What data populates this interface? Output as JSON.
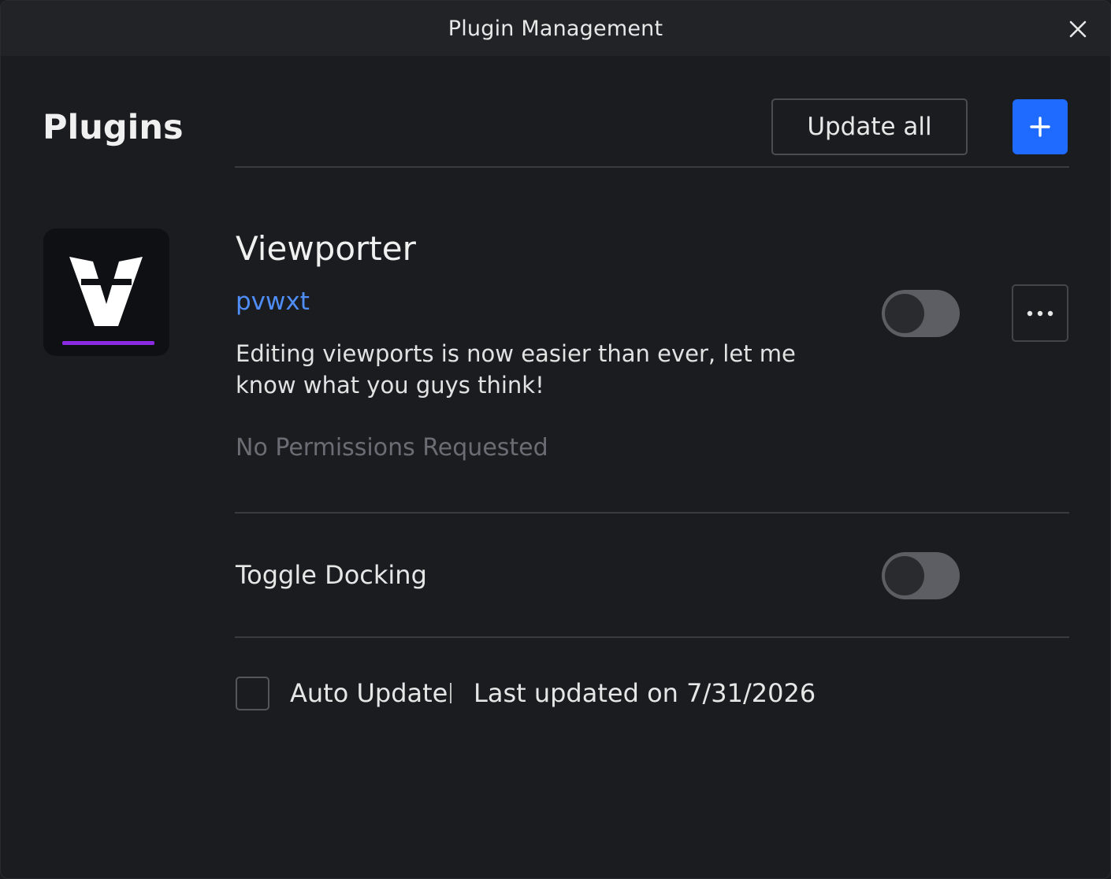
{
  "window": {
    "title": "Plugin Management",
    "close_icon": "close-icon"
  },
  "header": {
    "title": "Plugins",
    "update_all_label": "Update all",
    "add_icon": "plus-icon",
    "accent_color": "#1f6bff"
  },
  "plugin": {
    "name": "Viewporter",
    "author": "pvwxt",
    "description": "Editing viewports is now easier than ever, let me know what you guys think!",
    "permissions": "No Permissions Requested",
    "enabled": false,
    "icon": "viewporter-logo",
    "more_icon": "more-horizontal-icon"
  },
  "settings": [
    {
      "label": "Toggle Docking",
      "enabled": false
    }
  ],
  "footer": {
    "auto_update_label": "Auto Update",
    "auto_update_checked": false,
    "last_updated": "Last updated on 7/31/2026"
  }
}
